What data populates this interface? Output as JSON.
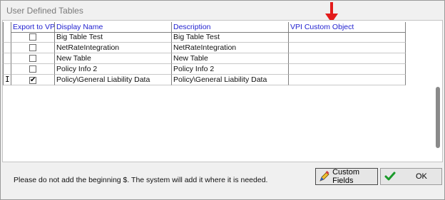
{
  "window": {
    "title": "User Defined Tables"
  },
  "grid": {
    "columns": {
      "export": "Export to VPI",
      "display_name": "Display Name",
      "description": "Description",
      "vpi_object": "VPI Custom Object"
    },
    "rows": [
      {
        "display_name": "Big Table Test",
        "description": "Big Table Test",
        "vpi_object": "",
        "export_checked": false
      },
      {
        "display_name": "NetRateIntegration",
        "description": "NetRateIntegration",
        "vpi_object": "",
        "export_checked": false
      },
      {
        "display_name": "New Table",
        "description": "New Table",
        "vpi_object": "",
        "export_checked": false
      },
      {
        "display_name": "Policy Info 2",
        "description": "Policy Info 2",
        "vpi_object": "",
        "export_checked": false
      },
      {
        "display_name": "Policy\\General Liability Data",
        "description": "Policy\\General Liability Data",
        "vpi_object": "",
        "export_checked": true
      }
    ],
    "checkmark": "✔"
  },
  "footer": {
    "note": "Please do not add the beginning $. The system will add it where it is needed.",
    "custom_fields_label": "Custom Fields",
    "ok_label": "OK"
  },
  "icons": {
    "annotation_arrow": "red-down-arrow-icon",
    "custom_fields": "pencil-icon",
    "ok": "green-check-icon"
  },
  "colors": {
    "header_text": "#1f1fcf",
    "arrow": "#e31b1b",
    "ok_check": "#1a9a2a"
  }
}
